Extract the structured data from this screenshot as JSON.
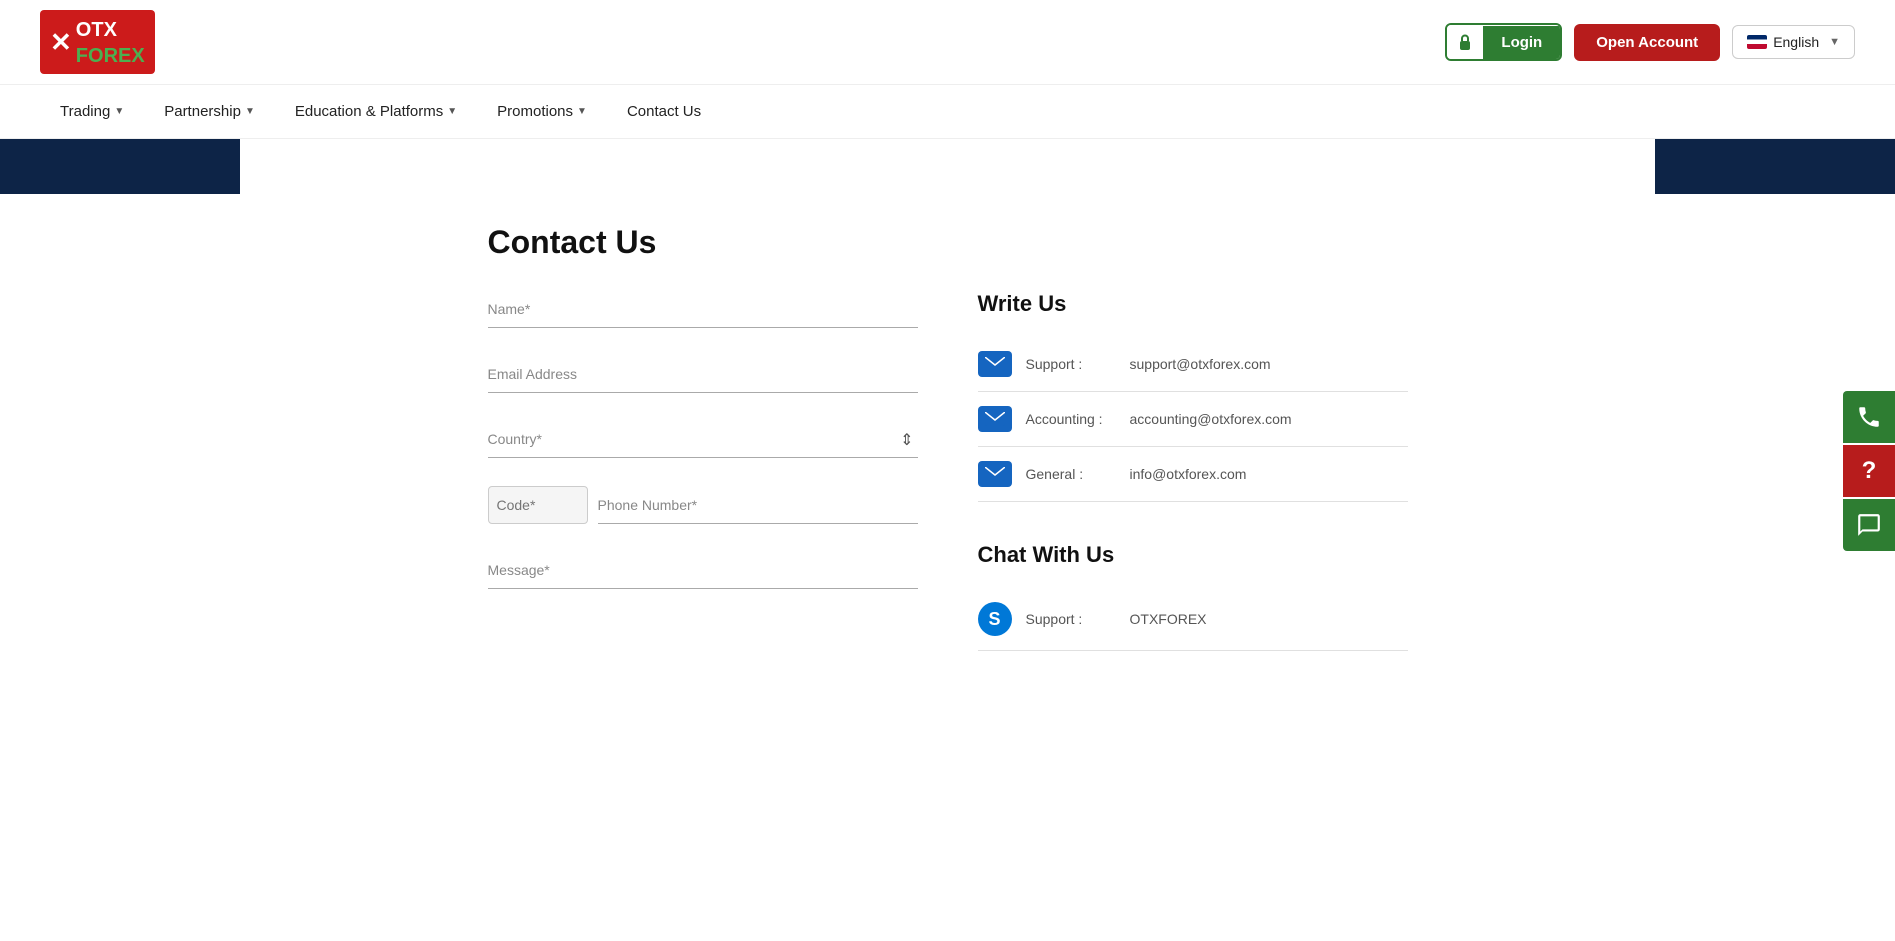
{
  "header": {
    "logo": {
      "prefix": "✕",
      "brand1": "OTX",
      "brand2": "FOREX"
    },
    "login_label": "Login",
    "open_account_label": "Open Account",
    "language": "English"
  },
  "nav": {
    "items": [
      {
        "label": "Trading",
        "has_dropdown": true
      },
      {
        "label": "Partnership",
        "has_dropdown": true
      },
      {
        "label": "Education & Platforms",
        "has_dropdown": true
      },
      {
        "label": "Promotions",
        "has_dropdown": true
      },
      {
        "label": "Contact Us",
        "has_dropdown": false
      }
    ]
  },
  "page": {
    "title": "Contact Us"
  },
  "form": {
    "name_placeholder": "Name*",
    "email_placeholder": "Email Address",
    "country_placeholder": "Country*",
    "code_placeholder": "Code*",
    "phone_placeholder": "Phone Number*",
    "message_placeholder": "Message*"
  },
  "write_us": {
    "title": "Write Us",
    "contacts": [
      {
        "label": "Support :",
        "email": "support@otxforex.com"
      },
      {
        "label": "Accounting :",
        "email": "accounting@otxforex.com"
      },
      {
        "label": "General :",
        "email": "info@otxforex.com"
      }
    ]
  },
  "chat_us": {
    "title": "Chat With Us",
    "contacts": [
      {
        "label": "Support :",
        "value": "OTXFOREX"
      }
    ]
  },
  "floating": {
    "phone_icon": "📞",
    "question_icon": "?",
    "chat_icon": "💬"
  }
}
